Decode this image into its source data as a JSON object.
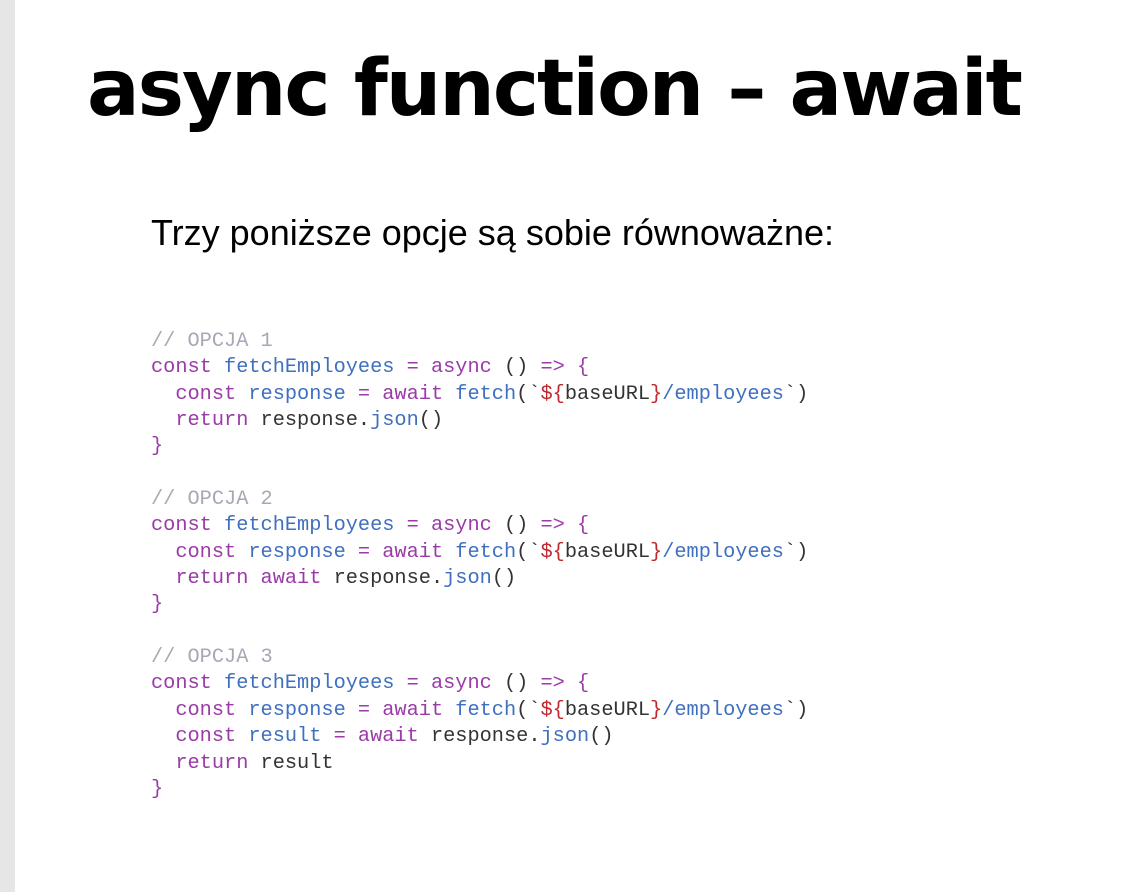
{
  "slide": {
    "title": "async function – await",
    "subtitle": "Trzy poniższe opcje są sobie równoważne:"
  },
  "code": {
    "blocks": [
      {
        "lines": [
          [
            [
              "comment",
              "// OPCJA 1"
            ]
          ],
          [
            [
              "keyword",
              "const"
            ],
            [
              "punct",
              " "
            ],
            [
              "def",
              "fetchEmployees"
            ],
            [
              "punct",
              " "
            ],
            [
              "op",
              "="
            ],
            [
              "punct",
              " "
            ],
            [
              "keyword",
              "async"
            ],
            [
              "punct",
              " () "
            ],
            [
              "op",
              "=>"
            ],
            [
              "punct",
              " "
            ],
            [
              "brace",
              "{"
            ]
          ],
          [
            [
              "punct",
              "  "
            ],
            [
              "keyword",
              "const"
            ],
            [
              "punct",
              " "
            ],
            [
              "def",
              "response"
            ],
            [
              "punct",
              " "
            ],
            [
              "op",
              "="
            ],
            [
              "punct",
              " "
            ],
            [
              "keyword",
              "await"
            ],
            [
              "punct",
              " "
            ],
            [
              "def",
              "fetch"
            ],
            [
              "punct",
              "(`"
            ],
            [
              "interp",
              "${"
            ],
            [
              "var",
              "baseURL"
            ],
            [
              "interp",
              "}"
            ],
            [
              "string",
              "/employees"
            ],
            [
              "punct",
              "`)"
            ]
          ],
          [
            [
              "punct",
              "  "
            ],
            [
              "keyword",
              "return"
            ],
            [
              "punct",
              " "
            ],
            [
              "var",
              "response"
            ],
            [
              "punct",
              "."
            ],
            [
              "prop",
              "json"
            ],
            [
              "punct",
              "()"
            ]
          ],
          [
            [
              "brace",
              "}"
            ]
          ]
        ]
      },
      {
        "lines": [
          [
            [
              "comment",
              "// OPCJA 2"
            ]
          ],
          [
            [
              "keyword",
              "const"
            ],
            [
              "punct",
              " "
            ],
            [
              "def",
              "fetchEmployees"
            ],
            [
              "punct",
              " "
            ],
            [
              "op",
              "="
            ],
            [
              "punct",
              " "
            ],
            [
              "keyword",
              "async"
            ],
            [
              "punct",
              " () "
            ],
            [
              "op",
              "=>"
            ],
            [
              "punct",
              " "
            ],
            [
              "brace",
              "{"
            ]
          ],
          [
            [
              "punct",
              "  "
            ],
            [
              "keyword",
              "const"
            ],
            [
              "punct",
              " "
            ],
            [
              "def",
              "response"
            ],
            [
              "punct",
              " "
            ],
            [
              "op",
              "="
            ],
            [
              "punct",
              " "
            ],
            [
              "keyword",
              "await"
            ],
            [
              "punct",
              " "
            ],
            [
              "def",
              "fetch"
            ],
            [
              "punct",
              "(`"
            ],
            [
              "interp",
              "${"
            ],
            [
              "var",
              "baseURL"
            ],
            [
              "interp",
              "}"
            ],
            [
              "string",
              "/employees"
            ],
            [
              "punct",
              "`)"
            ]
          ],
          [
            [
              "punct",
              "  "
            ],
            [
              "keyword",
              "return"
            ],
            [
              "punct",
              " "
            ],
            [
              "keyword",
              "await"
            ],
            [
              "punct",
              " "
            ],
            [
              "var",
              "response"
            ],
            [
              "punct",
              "."
            ],
            [
              "prop",
              "json"
            ],
            [
              "punct",
              "()"
            ]
          ],
          [
            [
              "brace",
              "}"
            ]
          ]
        ]
      },
      {
        "lines": [
          [
            [
              "comment",
              "// OPCJA 3"
            ]
          ],
          [
            [
              "keyword",
              "const"
            ],
            [
              "punct",
              " "
            ],
            [
              "def",
              "fetchEmployees"
            ],
            [
              "punct",
              " "
            ],
            [
              "op",
              "="
            ],
            [
              "punct",
              " "
            ],
            [
              "keyword",
              "async"
            ],
            [
              "punct",
              " () "
            ],
            [
              "op",
              "=>"
            ],
            [
              "punct",
              " "
            ],
            [
              "brace",
              "{"
            ]
          ],
          [
            [
              "punct",
              "  "
            ],
            [
              "keyword",
              "const"
            ],
            [
              "punct",
              " "
            ],
            [
              "def",
              "response"
            ],
            [
              "punct",
              " "
            ],
            [
              "op",
              "="
            ],
            [
              "punct",
              " "
            ],
            [
              "keyword",
              "await"
            ],
            [
              "punct",
              " "
            ],
            [
              "def",
              "fetch"
            ],
            [
              "punct",
              "(`"
            ],
            [
              "interp",
              "${"
            ],
            [
              "var",
              "baseURL"
            ],
            [
              "interp",
              "}"
            ],
            [
              "string",
              "/employees"
            ],
            [
              "punct",
              "`)"
            ]
          ],
          [
            [
              "punct",
              "  "
            ],
            [
              "keyword",
              "const"
            ],
            [
              "punct",
              " "
            ],
            [
              "def",
              "result"
            ],
            [
              "punct",
              " "
            ],
            [
              "op",
              "="
            ],
            [
              "punct",
              " "
            ],
            [
              "keyword",
              "await"
            ],
            [
              "punct",
              " "
            ],
            [
              "var",
              "response"
            ],
            [
              "punct",
              "."
            ],
            [
              "prop",
              "json"
            ],
            [
              "punct",
              "()"
            ]
          ],
          [
            [
              "punct",
              "  "
            ],
            [
              "keyword",
              "return"
            ],
            [
              "punct",
              " "
            ],
            [
              "var",
              "result"
            ]
          ],
          [
            [
              "brace",
              "}"
            ]
          ]
        ]
      }
    ]
  },
  "colors": {
    "background": "#ffffff",
    "left_rail": "#e6e6e6",
    "title_text": "#000000",
    "comment": "#a6a8b5",
    "keyword": "#9b3aa8",
    "definition": "#3f6fbf",
    "string": "#3f6fbf",
    "interpolation": "#c1272d",
    "plain": "#333333"
  }
}
